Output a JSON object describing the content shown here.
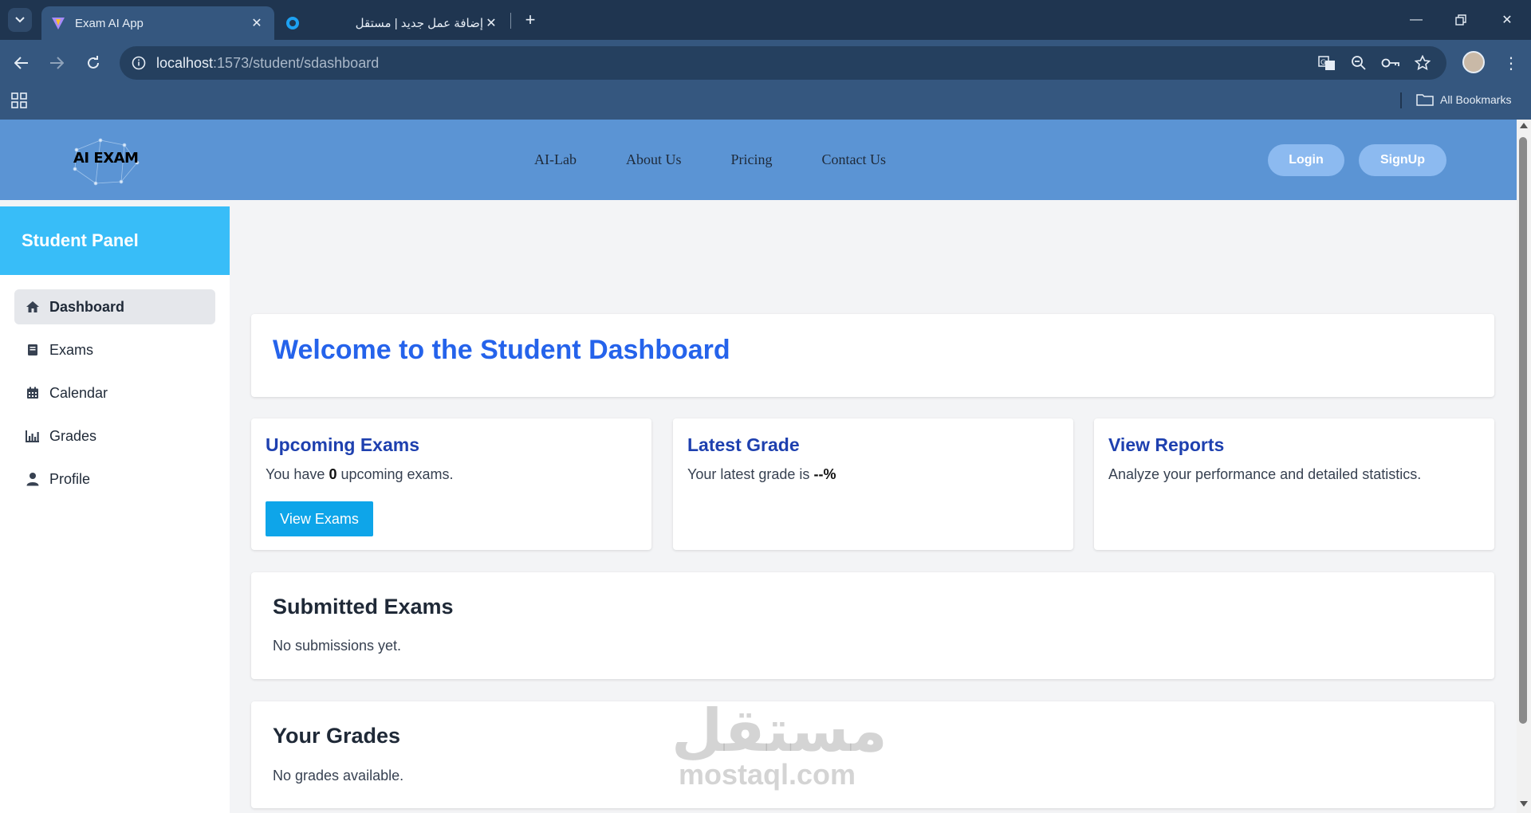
{
  "browser": {
    "tabs": [
      {
        "title": "Exam AI App",
        "active": true
      },
      {
        "title": "إضافة عمل جديد | مستقل",
        "active": false
      }
    ],
    "url_host": "localhost",
    "url_path": ":1573/student/sdashboard",
    "bookmarks_label": "All Bookmarks"
  },
  "site": {
    "logo_text": "AI EXAM",
    "nav": [
      "AI-Lab",
      "About Us",
      "Pricing",
      "Contact Us"
    ],
    "login": "Login",
    "signup": "SignUp"
  },
  "sidebar": {
    "title": "Student Panel",
    "items": [
      {
        "label": "Dashboard",
        "icon": "home-icon",
        "active": true
      },
      {
        "label": "Exams",
        "icon": "book-icon",
        "active": false
      },
      {
        "label": "Calendar",
        "icon": "calendar-icon",
        "active": false
      },
      {
        "label": "Grades",
        "icon": "chart-icon",
        "active": false
      },
      {
        "label": "Profile",
        "icon": "user-icon",
        "active": false
      }
    ]
  },
  "main": {
    "welcome": "Welcome to the Student Dashboard",
    "cards": {
      "upcoming": {
        "title": "Upcoming Exams",
        "prefix": "You have",
        "count": "0",
        "suffix": "upcoming exams.",
        "button": "View Exams"
      },
      "grade": {
        "title": "Latest Grade",
        "prefix": "Your latest grade is",
        "value": "--%"
      },
      "reports": {
        "title": "View Reports",
        "text": "Analyze your performance and detailed statistics."
      }
    },
    "submitted": {
      "title": "Submitted Exams",
      "empty": "No submissions yet."
    },
    "grades": {
      "title": "Your Grades",
      "empty": "No grades available."
    }
  },
  "watermark": {
    "arabic": "مستقل",
    "latin": "mostaql.com"
  },
  "colors": {
    "header": "#5b94d4",
    "sidebar_head": "#38bdf8",
    "accent": "#2563eb",
    "button": "#0ea5e9"
  }
}
